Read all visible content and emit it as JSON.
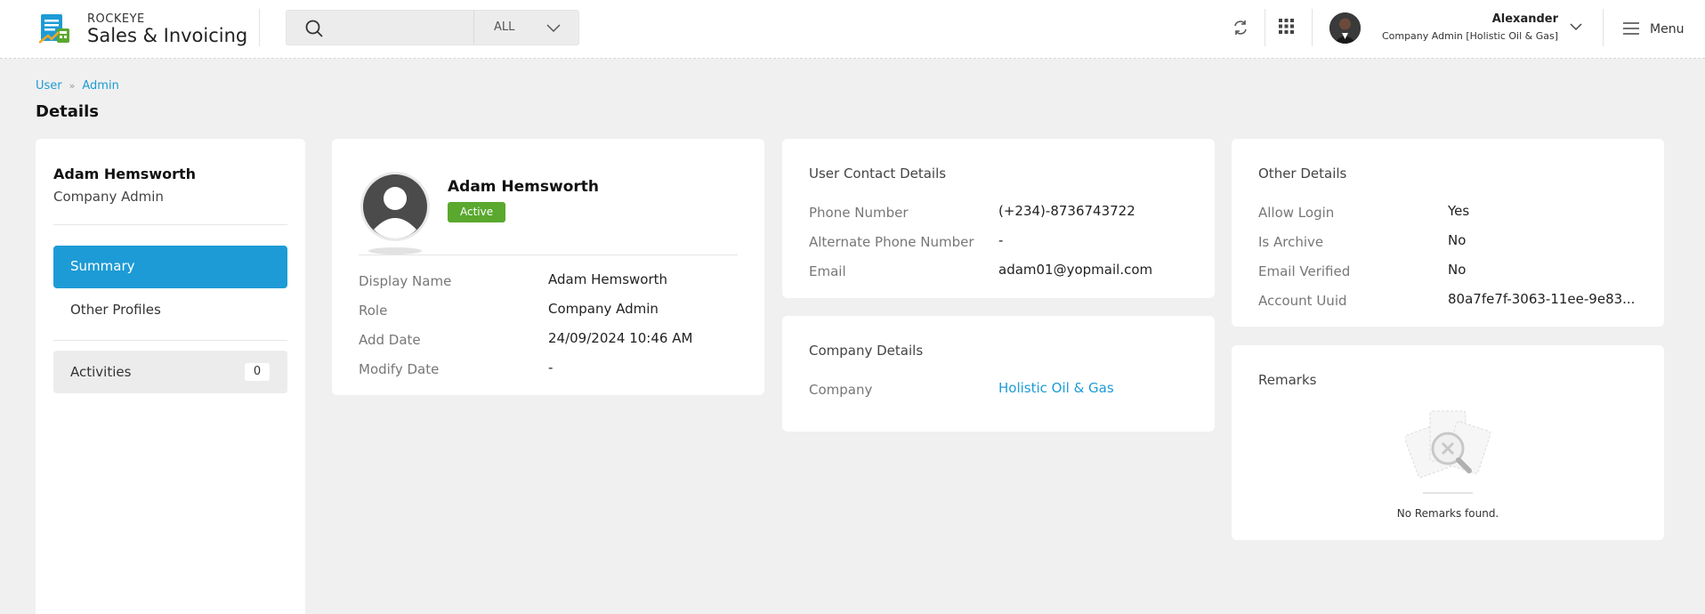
{
  "header": {
    "brand_small": "ROCKEYE",
    "brand_big": "Sales & Invoicing",
    "search_placeholder": "",
    "search_filter": "ALL",
    "user_name": "Alexander",
    "user_role": "Company Admin [Holistic Oil & Gas]",
    "menu_label": "Menu",
    "icons": [
      "search-icon",
      "refresh-icon",
      "apps-grid-icon",
      "chevron-down-icon",
      "hamburger-menu-icon"
    ]
  },
  "breadcrumb": {
    "items": [
      "User",
      "Admin"
    ]
  },
  "page_title": "Details",
  "sidebar": {
    "name": "Adam Hemsworth",
    "role": "Company Admin",
    "items": [
      {
        "label": "Summary",
        "active": true
      },
      {
        "label": "Other Profiles",
        "active": false
      }
    ],
    "activities": {
      "label": "Activities",
      "count": "0"
    }
  },
  "profile": {
    "name": "Adam Hemsworth",
    "status": "Active",
    "rows": [
      {
        "label": "Display Name",
        "value": "Adam Hemsworth"
      },
      {
        "label": "Role",
        "value": "Company Admin"
      },
      {
        "label": "Add Date",
        "value": "24/09/2024 10:46 AM"
      },
      {
        "label": "Modify Date",
        "value": "-"
      }
    ]
  },
  "contact": {
    "title": "User Contact Details",
    "rows": [
      {
        "label": "Phone Number",
        "value": "(+234)-8736743722"
      },
      {
        "label": "Alternate Phone Number",
        "value": "-"
      },
      {
        "label": "Email",
        "value": "adam01@yopmail.com"
      }
    ]
  },
  "company": {
    "title": "Company Details",
    "rows": [
      {
        "label": "Company",
        "value": "Holistic Oil & Gas"
      }
    ]
  },
  "other": {
    "title": "Other Details",
    "rows": [
      {
        "label": "Allow Login",
        "value": "Yes"
      },
      {
        "label": "Is Archive",
        "value": "No"
      },
      {
        "label": "Email Verified",
        "value": "No"
      },
      {
        "label": "Account Uuid",
        "value": "80a7fe7f-3063-11ee-9e83..."
      }
    ]
  },
  "remarks": {
    "title": "Remarks",
    "empty_text": "No Remarks found."
  },
  "colors": {
    "accent": "#1d9bd6",
    "status_active": "#5aa82e",
    "background": "#f0f0f0"
  }
}
